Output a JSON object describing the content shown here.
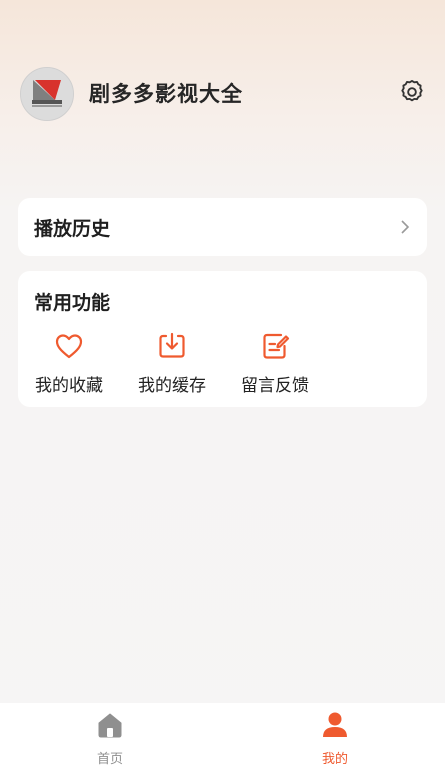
{
  "app": {
    "name": "剧多多影视大全"
  },
  "history": {
    "label": "播放历史"
  },
  "functions": {
    "title": "常用功能",
    "items": [
      {
        "label": "我的收藏",
        "icon": "heart-icon"
      },
      {
        "label": "我的缓存",
        "icon": "download-icon"
      },
      {
        "label": "留言反馈",
        "icon": "feedback-icon"
      }
    ]
  },
  "tabs": [
    {
      "label": "首页",
      "icon": "home-icon",
      "active": false
    },
    {
      "label": "我的",
      "icon": "user-icon",
      "active": true
    }
  ],
  "colors": {
    "accent": "#ef5a2f",
    "inactive": "#8f8f8f"
  }
}
